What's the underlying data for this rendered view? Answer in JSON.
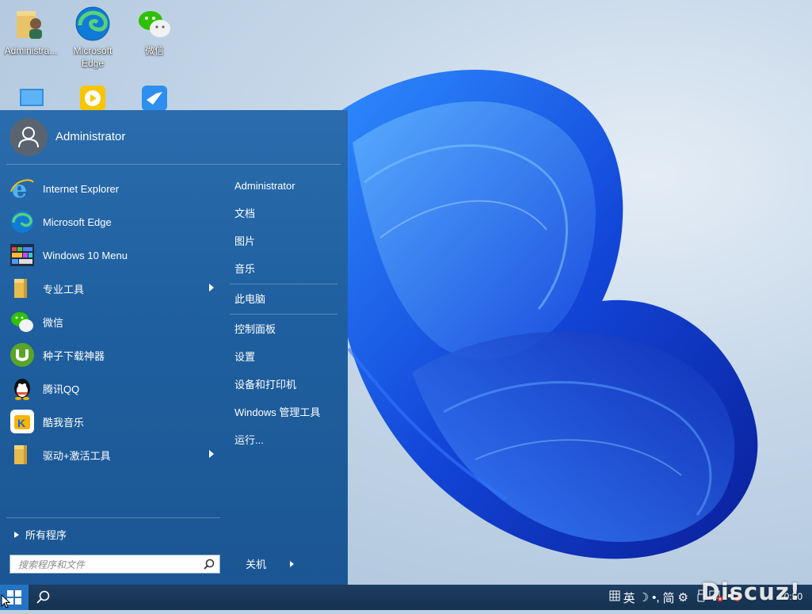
{
  "desktop": {
    "icons": [
      {
        "label": "Administra..."
      },
      {
        "label": "Microsoft Edge"
      },
      {
        "label": "微信"
      },
      {
        "label": ""
      },
      {
        "label": ""
      },
      {
        "label": ""
      }
    ]
  },
  "start_menu": {
    "user_name": "Administrator",
    "apps": [
      {
        "label": "Internet Explorer",
        "icon": "ie-icon"
      },
      {
        "label": "Microsoft Edge",
        "icon": "edge-icon"
      },
      {
        "label": "Windows 10 Menu",
        "icon": "windows10-menu-icon"
      },
      {
        "label": "专业工具",
        "icon": "folder-icon",
        "submenu": true
      },
      {
        "label": "微信",
        "icon": "wechat-icon"
      },
      {
        "label": "种子下载神器",
        "icon": "utorrent-icon"
      },
      {
        "label": "腾讯QQ",
        "icon": "qq-icon"
      },
      {
        "label": "酷我音乐",
        "icon": "kuwo-icon"
      },
      {
        "label": "驱动+激活工具",
        "icon": "folder-icon",
        "submenu": true
      }
    ],
    "all_programs": "所有程序",
    "search_placeholder": "搜索程序和文件",
    "places": [
      "Administrator",
      "文档",
      "图片",
      "音乐",
      "此电脑",
      "控制面板",
      "设置",
      "设备和打印机",
      "Windows 管理工具",
      "运行..."
    ],
    "shutdown_label": "关机"
  },
  "taskbar": {
    "tray_ime_lang": "英",
    "tray_ime_mode": "简",
    "clock": "0:50",
    "watermark": "Discuz!"
  },
  "colors": {
    "menu_bg": "#1f5f9f",
    "taskbar_bg": "#15324f",
    "start_button": "#2474c4"
  }
}
